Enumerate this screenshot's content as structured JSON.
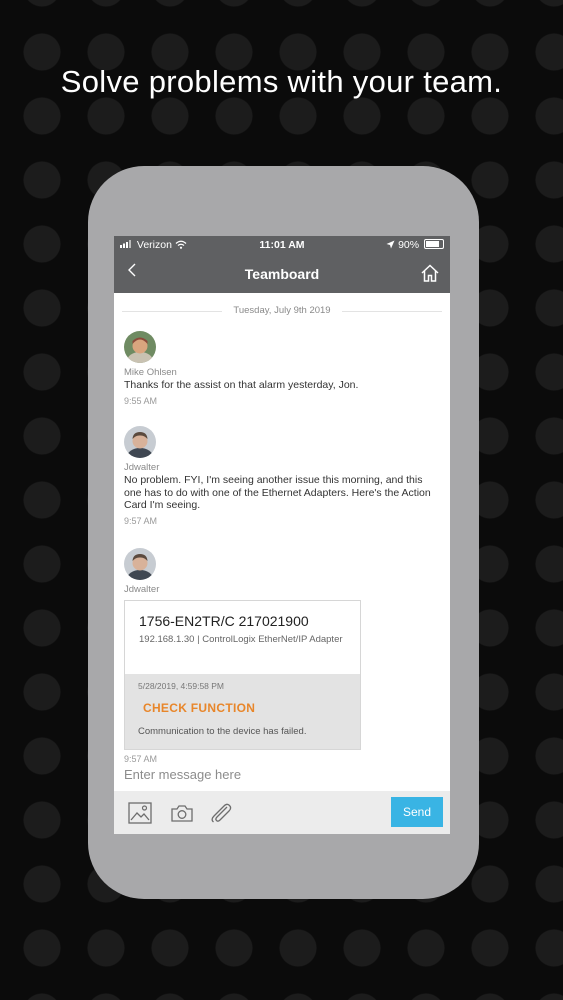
{
  "headline": "Solve problems with your team.",
  "status_bar": {
    "carrier": "Verizon",
    "time": "11:01 AM",
    "battery": "90%"
  },
  "nav": {
    "back_icon": "chevron-left-icon",
    "title": "Teamboard",
    "home_icon": "home-icon"
  },
  "chat": {
    "date_separator": "Tuesday, July 9th 2019",
    "messages": [
      {
        "sender": "Mike Ohlsen",
        "text": "Thanks for the assist on that alarm yesterday, Jon.",
        "time": "9:55 AM"
      },
      {
        "sender": "Jdwalter",
        "text": "No problem. FYI, I'm seeing another issue this morning, and this one has to do with one of the Ethernet Adapters. Here's the Action Card I'm seeing.",
        "time": "9:57 AM"
      },
      {
        "sender": "Jdwalter",
        "time": "9:57 AM"
      }
    ],
    "action_card": {
      "title": "1756-EN2TR/C 217021900",
      "subtitle": "192.168.1.30 | ControlLogix EtherNet/IP Adapter",
      "timestamp": "5/28/2019, 4:59:58 PM",
      "action": "CHECK FUNCTION",
      "description": "Communication to the device has failed."
    }
  },
  "composer": {
    "placeholder": "Enter message here",
    "icons": [
      "image-icon",
      "camera-icon",
      "paperclip-icon"
    ],
    "send_label": "Send",
    "send_color": "#39b4e4"
  }
}
